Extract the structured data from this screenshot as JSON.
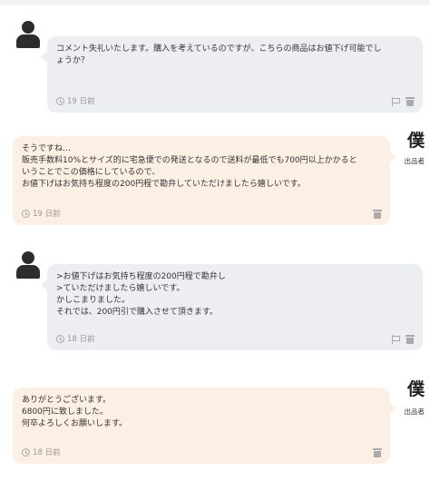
{
  "messages": [
    {
      "role": "buyer",
      "lines": [
        "コメント失礼いたします。購入を考えているのですが、こちらの商品はお値下げ可能でし",
        "ょうか？"
      ],
      "time": "19 日前"
    },
    {
      "role": "seller",
      "name": "僕",
      "badge": "出品者",
      "lines": [
        "そうですね…",
        "販売手数料10%とサイズ的に宅急便での発送となるので送料が最低でも700円以上かかると",
        "いうことでこの価格にしているので、",
        "お値下げはお気持ち程度の200円程で勘弁していただけましたら嬉しいです。"
      ],
      "time": "19 日前"
    },
    {
      "role": "buyer",
      "lines": [
        ">お値下げはお気持ち程度の200円程で勘弁し",
        ">ていただけましたら嬉しいです。",
        "かしこまりました。",
        "それでは、200円引で購入させて頂きます。"
      ],
      "time": "18 日前"
    },
    {
      "role": "seller",
      "name": "僕",
      "badge": "出品者",
      "lines": [
        "ありがとうございます。",
        "6800円に致しました。",
        "何卒よろしくお願いします。"
      ],
      "time": "18 日前"
    }
  ]
}
